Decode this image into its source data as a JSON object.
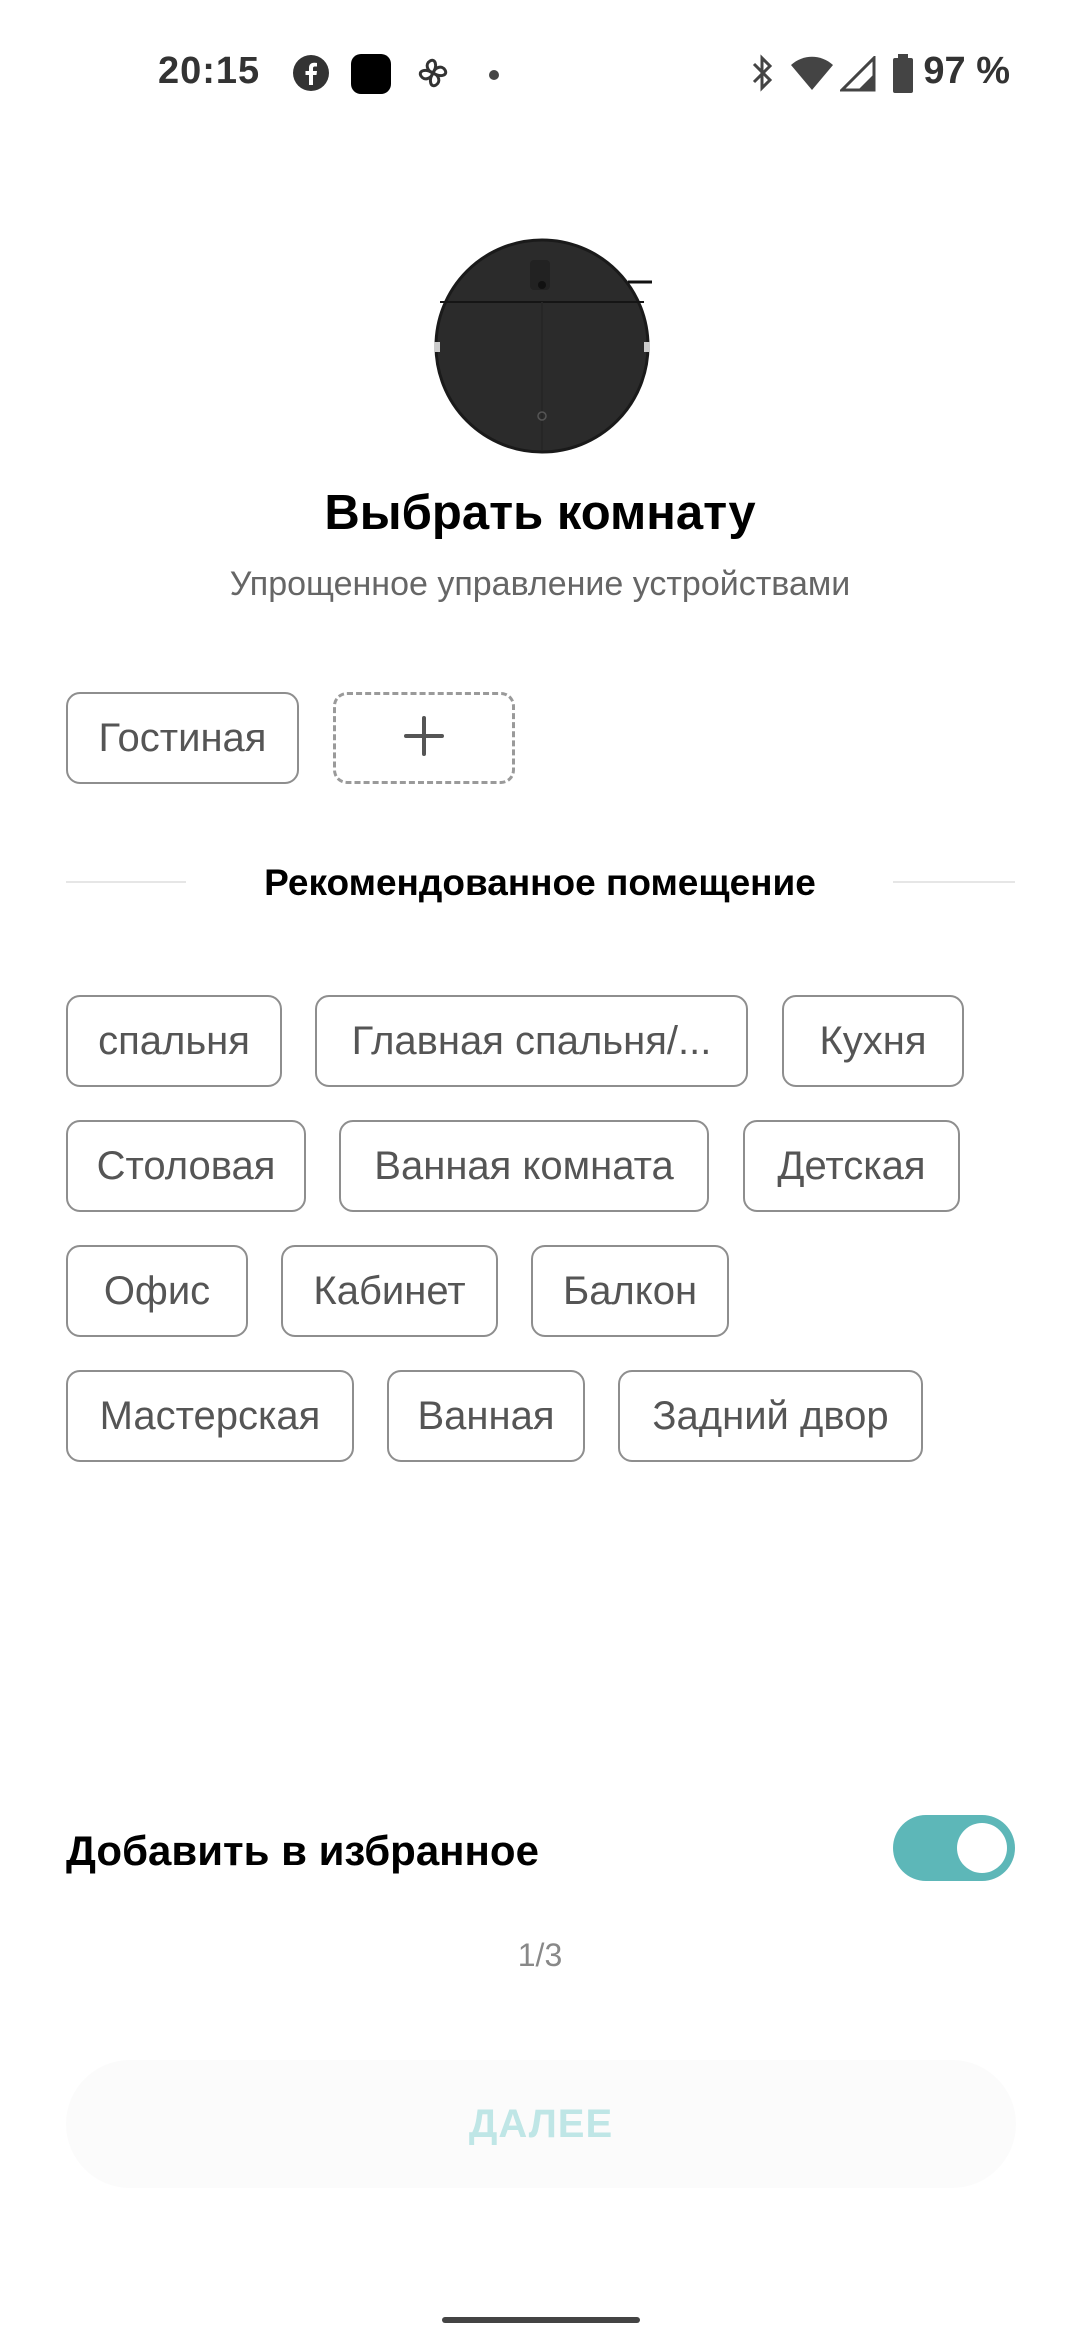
{
  "status_bar": {
    "time": "20:15",
    "battery": "97 %",
    "icons": [
      "facebook-icon",
      "app-square-icon",
      "pinwheel-icon",
      "dot-icon",
      "bluetooth-icon",
      "wifi-icon",
      "signal-icon",
      "battery-icon"
    ]
  },
  "header": {
    "image": "robot-vacuum-image",
    "title": "Выбрать комнату",
    "subtitle": "Упрощенное управление устройствами"
  },
  "my_rooms": {
    "items": [
      {
        "label": "Гостиная"
      }
    ],
    "add_icon": "plus-icon"
  },
  "recommended": {
    "title": "Рекомендованное помещение",
    "items": [
      {
        "label": "спальня"
      },
      {
        "label": "Главная спальня/..."
      },
      {
        "label": "Кухня"
      },
      {
        "label": "Столовая"
      },
      {
        "label": "Ванная комната"
      },
      {
        "label": "Детская"
      },
      {
        "label": "Офис"
      },
      {
        "label": "Кабинет"
      },
      {
        "label": "Балкон"
      },
      {
        "label": "Мастерская"
      },
      {
        "label": "Ванная"
      },
      {
        "label": "Задний двор"
      }
    ]
  },
  "favorite": {
    "label": "Добавить в избранное",
    "enabled": true
  },
  "pager": "1/3",
  "next_button": "ДАЛЕЕ",
  "colors": {
    "accent": "#5db7b8",
    "button_text_disabled": "#bfe6e6"
  }
}
